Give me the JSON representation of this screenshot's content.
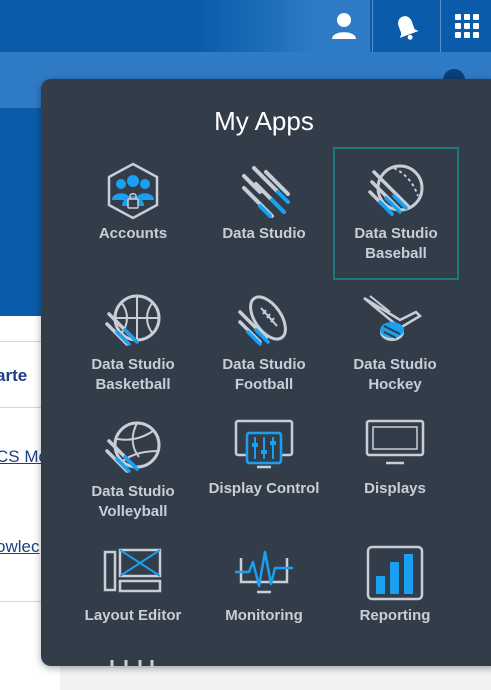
{
  "header": {
    "user_icon": "user-icon",
    "bell_icon": "bell-icon",
    "apps_icon": "app-grid-icon"
  },
  "background_page": {
    "fragments": [
      "arte",
      "CS Mo",
      "owlec"
    ]
  },
  "apps_menu": {
    "title": "My Apps",
    "apps": [
      {
        "name": "accounts",
        "label": "Accounts",
        "icon": "accounts-icon"
      },
      {
        "name": "data-studio",
        "label": "Data Studio",
        "icon": "data-studio-icon"
      },
      {
        "name": "data-studio-baseball",
        "label": "Data Studio Baseball",
        "icon": "baseball-icon",
        "selected": true
      },
      {
        "name": "data-studio-basketball",
        "label": "Data Studio Basketball",
        "icon": "basketball-icon"
      },
      {
        "name": "data-studio-football",
        "label": "Data Studio Football",
        "icon": "football-icon"
      },
      {
        "name": "data-studio-hockey",
        "label": "Data Studio Hockey",
        "icon": "hockey-icon"
      },
      {
        "name": "data-studio-volleyball",
        "label": "Data Studio Volleyball",
        "icon": "volleyball-icon"
      },
      {
        "name": "display-control",
        "label": "Display Control",
        "icon": "display-control-icon"
      },
      {
        "name": "displays",
        "label": "Displays",
        "icon": "monitor-icon"
      },
      {
        "name": "layout-editor",
        "label": "Layout Editor",
        "icon": "layout-editor-icon"
      },
      {
        "name": "monitoring",
        "label": "Monitoring",
        "icon": "monitoring-icon"
      },
      {
        "name": "reporting",
        "label": "Reporting",
        "icon": "reporting-icon"
      }
    ]
  },
  "colors": {
    "header_blue": "#0a5cab",
    "panel_bg": "#333d49",
    "accent_blue": "#1aa0f0",
    "selected_border": "#1b7a80"
  }
}
